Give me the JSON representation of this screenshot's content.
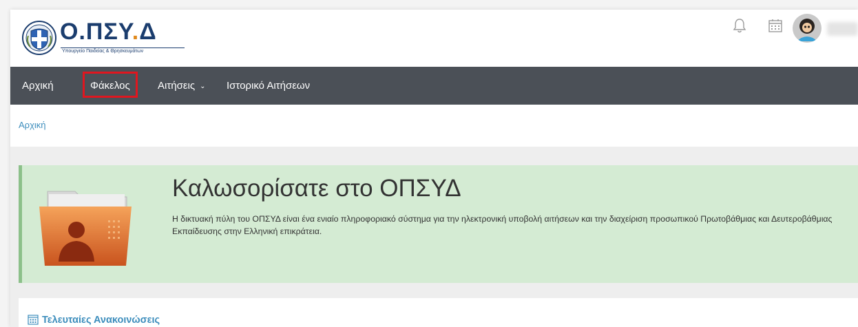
{
  "header": {
    "logo_title_main": "Ο.ΠΣΥ",
    "logo_title_dot": ".",
    "logo_title_end": "Δ",
    "logo_subtitle": "Υπουργείο Παιδείας & Θρησκευμάτων"
  },
  "nav": {
    "items": [
      {
        "label": "Αρχική"
      },
      {
        "label": "Φάκελος"
      },
      {
        "label": "Αιτήσεις"
      },
      {
        "label": "Ιστορικό Αιτήσεων"
      }
    ]
  },
  "breadcrumb": {
    "home": "Αρχική"
  },
  "welcome": {
    "title": "Καλωσορίσατε στο ΟΠΣΥΔ",
    "text": "Η δικτυακή πύλη του ΟΠΣΥΔ είναι ένα ενιαίο πληροφοριακό σύστημα για την ηλεκτρονική υποβολή αιτήσεων και την διαχείριση προσωπικού Πρωτοβάθμιας και Δευτεροβάθμιας Εκπαίδευσης στην Ελληνική επικράτεια."
  },
  "announcements": {
    "title": "Τελευταίες Ανακοινώσεις"
  },
  "colors": {
    "navbar_bg": "#4b5057",
    "highlight_border": "#e0161f",
    "welcome_bg": "#d4ebd3",
    "link": "#3c8dbc",
    "brand_blue": "#1b3d6e"
  },
  "icons": {
    "notifications": "bell-icon",
    "calendar": "calendar-icon",
    "user": "avatar",
    "nav_dropdown": "chevron-down-icon",
    "welcome": "user-folder-icon",
    "announcements": "calendar-icon"
  }
}
